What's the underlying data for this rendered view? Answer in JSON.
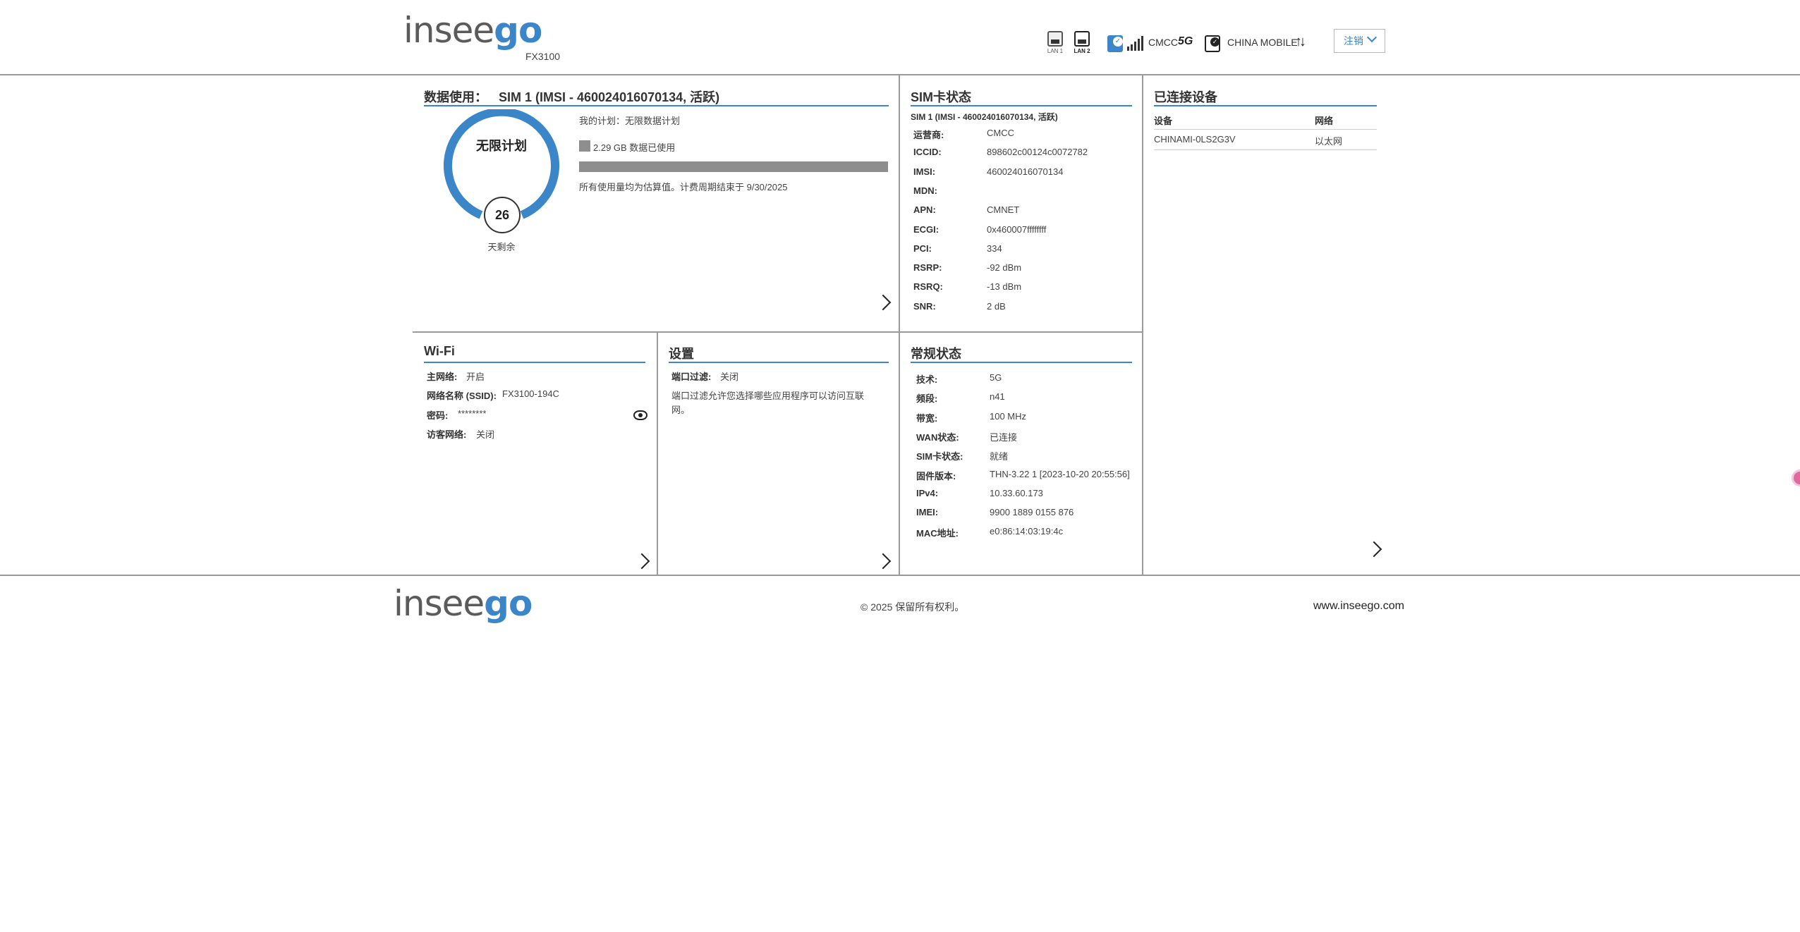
{
  "header": {
    "logo_left": "insee",
    "logo_right": "go",
    "model": "FX3100",
    "lan1_label": "LAN 1",
    "lan2_label": "LAN 2",
    "carrier_short": "CMCC",
    "network_type": "5G",
    "carrier_long": "CHINA MOBILE",
    "logout_label": "注销"
  },
  "data_usage": {
    "title_label": "数据使用：",
    "title_sim": "SIM 1 (IMSI - 460024016070134, 活跃)",
    "plan_name": "无限计划",
    "days_remaining": "26",
    "days_label": "天剩余",
    "my_plan": "我的计划：无限数据计划",
    "used": "2.29 GB 数据已使用",
    "usage_fraction": 1.0,
    "note": "所有使用量均为估算值。计费周期结束于 9/30/2025"
  },
  "sim_status": {
    "title": "SIM卡状态",
    "subtitle": "SIM 1 (IMSI - 460024016070134, 活跃)",
    "rows": [
      {
        "k": "运营商:",
        "v": "CMCC"
      },
      {
        "k": "ICCID:",
        "v": "898602c00124c0072782"
      },
      {
        "k": "IMSI:",
        "v": "460024016070134"
      },
      {
        "k": "MDN:",
        "v": ""
      },
      {
        "k": "APN:",
        "v": "CMNET"
      },
      {
        "k": "ECGI:",
        "v": "0x460007ffffffff"
      },
      {
        "k": "PCI:",
        "v": "334"
      },
      {
        "k": "RSRP:",
        "v": "-92 dBm"
      },
      {
        "k": "RSRQ:",
        "v": "-13 dBm"
      },
      {
        "k": "SNR:",
        "v": "2 dB"
      }
    ]
  },
  "connected_devices": {
    "title": "已连接设备",
    "col_device": "设备",
    "col_network": "网络",
    "rows": [
      {
        "device": "CHINAMI-0LS2G3V",
        "network": "以太网"
      }
    ]
  },
  "wifi": {
    "title": "Wi-Fi",
    "rows": [
      {
        "k": "主网络:",
        "v": "开启"
      },
      {
        "k": "网络名称 (SSID):",
        "v": "FX3100-194C"
      },
      {
        "k": "密码:",
        "v": "********"
      },
      {
        "k": "访客网络:",
        "v": "关闭"
      }
    ]
  },
  "settings": {
    "title": "设置",
    "port_filter_label": "端口过滤:",
    "port_filter_value": "关闭",
    "description_line1": "端口过滤允许您选择哪些应用程序可以访问互联",
    "description_line2": "网。"
  },
  "general_status": {
    "title": "常规状态",
    "rows": [
      {
        "k": "技术:",
        "v": "5G"
      },
      {
        "k": "频段:",
        "v": "n41"
      },
      {
        "k": "带宽:",
        "v": "100 MHz"
      },
      {
        "k": "WAN状态:",
        "v": "已连接"
      },
      {
        "k": "SIM卡状态:",
        "v": "就绪"
      },
      {
        "k": "固件版本:",
        "v": "THN-3.22 1 [2023-10-20 20:55:56]"
      },
      {
        "k": "IPv4:",
        "v": "10.33.60.173"
      },
      {
        "k": "IMEI:",
        "v": "9900 1889 0155 876"
      },
      {
        "k": "MAC地址:",
        "v": "e0:86:14:03:19:4c"
      }
    ]
  },
  "footer": {
    "logo_left": "insee",
    "logo_right": "go",
    "copyright": "© 2025 保留所有权利。",
    "website": "www.inseego.com"
  },
  "colors": {
    "accent": "#3a86c8",
    "divider": "#9a9a9a",
    "usage_bar": "#8e8e8e"
  }
}
